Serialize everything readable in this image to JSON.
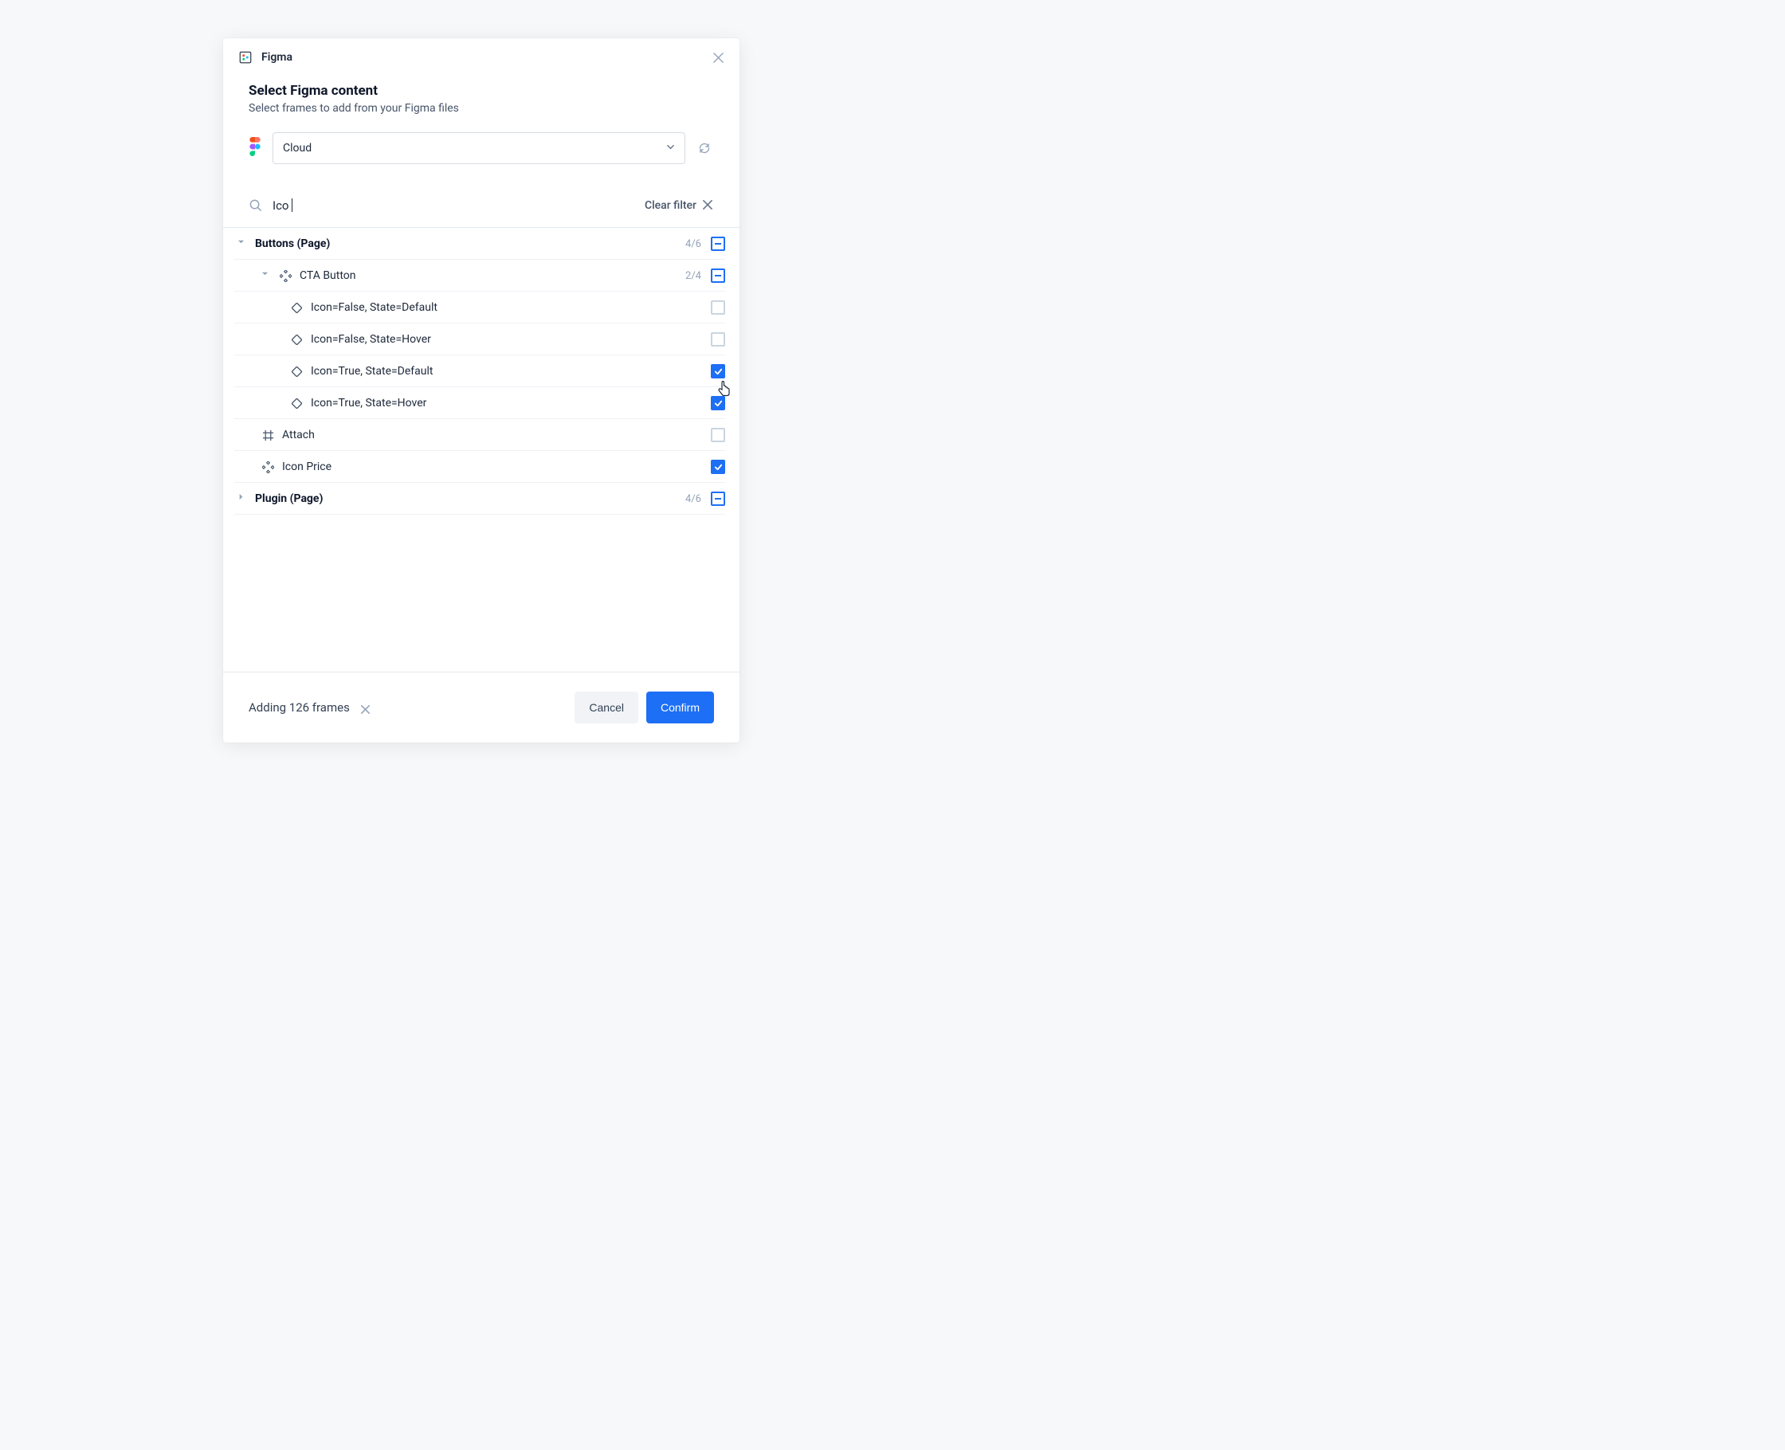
{
  "app": {
    "name": "Figma"
  },
  "header": {
    "title": "Select Figma content",
    "subtitle": "Select frames to add from your Figma files"
  },
  "dropdown": {
    "selected": "Cloud"
  },
  "search": {
    "value": "Ico",
    "clear_label": "Clear filter"
  },
  "tree": [
    {
      "level": 0,
      "caret": "down",
      "icon": null,
      "label": "Buttons (Page)",
      "bold": true,
      "count": "4/6",
      "state": "partial"
    },
    {
      "level": 1,
      "caret": "down",
      "icon": "component",
      "label": "CTA Button",
      "bold": false,
      "count": "2/4",
      "state": "partial"
    },
    {
      "level": 2,
      "caret": null,
      "icon": "diamond",
      "label": "Icon=False, State=Default",
      "bold": false,
      "count": null,
      "state": "unchecked"
    },
    {
      "level": 2,
      "caret": null,
      "icon": "diamond",
      "label": "Icon=False, State=Hover",
      "bold": false,
      "count": null,
      "state": "unchecked"
    },
    {
      "level": 2,
      "caret": null,
      "icon": "diamond",
      "label": "Icon=True, State=Default",
      "bold": false,
      "count": null,
      "state": "checked"
    },
    {
      "level": 2,
      "caret": null,
      "icon": "diamond",
      "label": "Icon=True, State=Hover",
      "bold": false,
      "count": null,
      "state": "checked"
    },
    {
      "level": 1,
      "caret": null,
      "icon": "frame",
      "label": "Attach",
      "bold": false,
      "count": null,
      "state": "unchecked"
    },
    {
      "level": 1,
      "caret": null,
      "icon": "component",
      "label": "Icon Price",
      "bold": false,
      "count": null,
      "state": "checked"
    },
    {
      "level": 0,
      "caret": "right",
      "icon": null,
      "label": "Plugin (Page)",
      "bold": true,
      "count": "4/6",
      "state": "partial"
    }
  ],
  "footer": {
    "status": "Adding 126 frames",
    "cancel": "Cancel",
    "confirm": "Confirm"
  }
}
